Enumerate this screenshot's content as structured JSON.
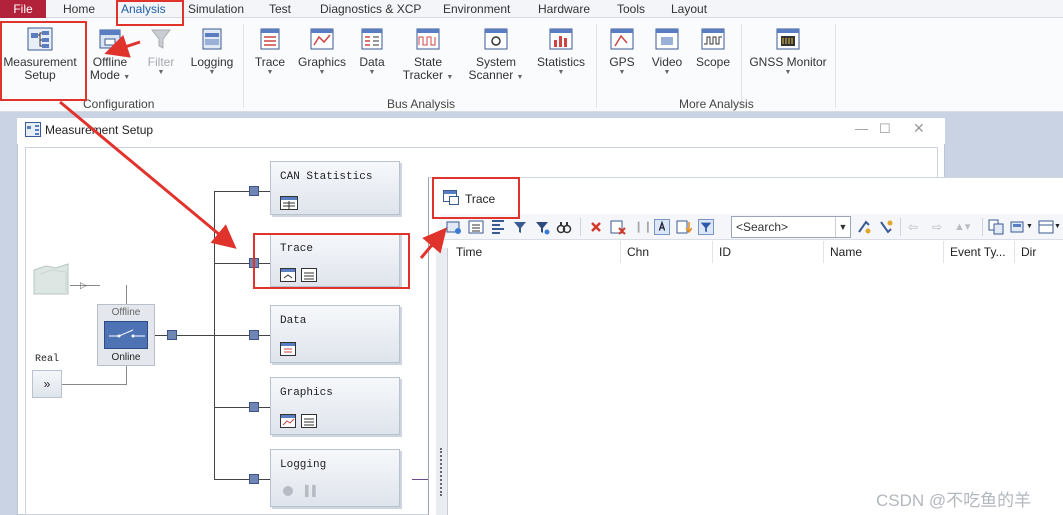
{
  "menu": {
    "file": "File",
    "home": "Home",
    "analysis": "Analysis",
    "simulation": "Simulation",
    "test": "Test",
    "diagnostics": "Diagnostics & XCP",
    "environment": "Environment",
    "hardware": "Hardware",
    "tools": "Tools",
    "layout": "Layout"
  },
  "ribbon": {
    "measurement_setup_1": "Measurement",
    "measurement_setup_2": "Setup",
    "offline_mode_1": "Offline",
    "offline_mode_2": "Mode",
    "filter": "Filter",
    "logging": "Logging",
    "trace": "Trace",
    "graphics": "Graphics",
    "data": "Data",
    "state_tracker_1": "State",
    "state_tracker_2": "Tracker",
    "system_scanner_1": "System",
    "system_scanner_2": "Scanner",
    "statistics": "Statistics",
    "gps": "GPS",
    "video": "Video",
    "scope": "Scope",
    "gnss_monitor": "GNSS Monitor",
    "group_configuration": "Configuration",
    "group_bus_analysis": "Bus Analysis",
    "group_more_analysis": "More Analysis"
  },
  "measurement_window": {
    "title": "Measurement Setup",
    "offline_label": "Offline",
    "online_label": "Online",
    "real_label": "Real",
    "blocks": {
      "can_statistics": "CAN Statistics",
      "trace": "Trace",
      "data": "Data",
      "graphics": "Graphics",
      "logging": "Logging"
    }
  },
  "trace_window": {
    "title": "Trace",
    "search_placeholder": "<Search>",
    "columns": {
      "time": "Time",
      "chn": "Chn",
      "id": "ID",
      "name": "Name",
      "event_type": "Event Ty...",
      "dir": "Dir"
    }
  },
  "watermark": "CSDN @不吃鱼的羊",
  "colors": {
    "file_menu_bg": "#b2223a",
    "annotation_red": "#e0332c",
    "block_port": "#6f86b3",
    "workspace_bg": "#c9d3e3"
  }
}
